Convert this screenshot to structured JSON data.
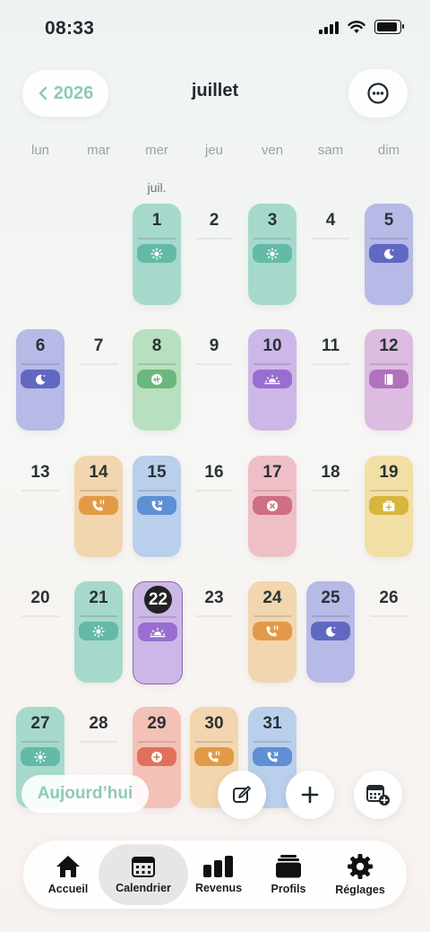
{
  "status": {
    "time": "08:33"
  },
  "header": {
    "year_label": "2026",
    "month_title": "juillet",
    "more_icon": "ellipsis-circle-icon"
  },
  "weekdays": [
    "lun",
    "mar",
    "mer",
    "jeu",
    "ven",
    "sam",
    "dim"
  ],
  "month_marker": "juil.",
  "today": 22,
  "days": [
    {
      "n": "1",
      "icon": "sun-icon",
      "color": "#a6d9cc",
      "pill": "#63baa6"
    },
    {
      "n": "2"
    },
    {
      "n": "3",
      "icon": "sun-icon",
      "color": "#a6d9cc",
      "pill": "#63baa6"
    },
    {
      "n": "4"
    },
    {
      "n": "5",
      "icon": "moon-icon",
      "color": "#b7b9e6",
      "pill": "#6168c2"
    },
    {
      "n": "6",
      "icon": "moon-icon",
      "color": "#b7b9e6",
      "pill": "#6168c2"
    },
    {
      "n": "7"
    },
    {
      "n": "8",
      "icon": "plane-icon",
      "color": "#b8dfbf",
      "pill": "#6bb77c"
    },
    {
      "n": "9"
    },
    {
      "n": "10",
      "icon": "sunrise-icon",
      "color": "#cdb7e8",
      "pill": "#9a6ed0"
    },
    {
      "n": "11"
    },
    {
      "n": "12",
      "icon": "book-icon",
      "color": "#dcbce0",
      "pill": "#b071bd"
    },
    {
      "n": "13"
    },
    {
      "n": "14",
      "icon": "phone-alert-icon",
      "color": "#f2d6af",
      "pill": "#e39a48"
    },
    {
      "n": "15",
      "icon": "phone-icon",
      "color": "#b9cfeb",
      "pill": "#5f8fd4"
    },
    {
      "n": "16"
    },
    {
      "n": "17",
      "icon": "x-circle-icon",
      "color": "#efbfc7",
      "pill": "#d06e83"
    },
    {
      "n": "18"
    },
    {
      "n": "19",
      "icon": "medkit-icon",
      "color": "#f1dfa5",
      "pill": "#d8b53e"
    },
    {
      "n": "20"
    },
    {
      "n": "21",
      "icon": "sun-icon",
      "color": "#a6d9cc",
      "pill": "#63baa6"
    },
    {
      "n": "22",
      "icon": "sunrise-icon",
      "color": "#cdb7e8",
      "pill": "#9a6ed0"
    },
    {
      "n": "23"
    },
    {
      "n": "24",
      "icon": "phone-alert-icon",
      "color": "#f2d6af",
      "pill": "#e39a48"
    },
    {
      "n": "25",
      "icon": "moon-icon",
      "color": "#b7b9e6",
      "pill": "#6168c2"
    },
    {
      "n": "26"
    },
    {
      "n": "27",
      "icon": "sun-icon",
      "color": "#a6d9cc",
      "pill": "#63baa6"
    },
    {
      "n": "28"
    },
    {
      "n": "29",
      "icon": "plus-circle-icon",
      "color": "#f3c1b6",
      "pill": "#e0705c"
    },
    {
      "n": "30",
      "icon": "phone-alert-icon",
      "color": "#f2d6af",
      "pill": "#e39a48"
    },
    {
      "n": "31",
      "icon": "phone-icon",
      "color": "#b9cfeb",
      "pill": "#5f8fd4"
    }
  ],
  "actions": {
    "today_label": "Aujourd’hui",
    "edit_icon": "edit-icon",
    "add_icon": "plus-icon",
    "calendar_add_icon": "calendar-plus-icon"
  },
  "tabs": [
    {
      "label": "Accueil",
      "icon": "home-icon"
    },
    {
      "label": "Calendrier",
      "icon": "calendar-icon",
      "active": true
    },
    {
      "label": "Revenus",
      "icon": "bar-chart-icon"
    },
    {
      "label": "Profils",
      "icon": "stack-icon"
    },
    {
      "label": "Réglages",
      "icon": "gear-icon"
    }
  ]
}
